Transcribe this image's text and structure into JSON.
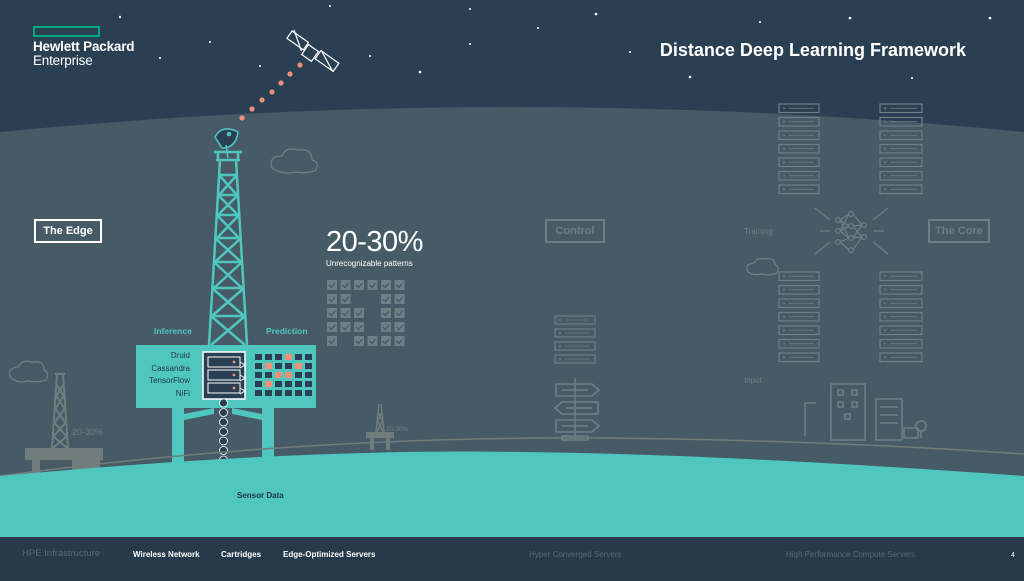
{
  "brand": {
    "line1": "Hewlett Packard",
    "line2": "Enterprise",
    "accent": "#01a982"
  },
  "title": "Distance Deep Learning Framework",
  "labels": {
    "the_edge": "The Edge",
    "control": "Control",
    "the_core": "The Core",
    "training": "Training",
    "input": "Input",
    "inference": "Inference",
    "prediction": "Prediction",
    "sensor_data": "Sensor Data"
  },
  "stat": {
    "value": "20-30%",
    "caption": "Unrecognizable patterns"
  },
  "small_stats": [
    "20-30%",
    "20-30%"
  ],
  "edge_stack": [
    "Druid",
    "Cassandra",
    "TensorFlow",
    "NiFi"
  ],
  "footer": {
    "hpe": "HPE Infrastructure",
    "items": [
      "Wireless Network",
      "Cartridges",
      "Edge-Optimized Servers",
      "Hyper Converged Servers",
      "High Performance Compute Servers"
    ]
  },
  "page_number": "4",
  "colors": {
    "background": "#2b3f52",
    "teal": "#4fc7bf",
    "ground": "#4fc7bf",
    "dim": "#6f7f86",
    "orange": "#f1907a",
    "white": "#ffffff"
  },
  "icons": [
    "satellite-icon",
    "satellite-dish-icon",
    "cloud-icon",
    "oil-rig-icon",
    "server-rack-icon",
    "neural-network-icon",
    "building-icon",
    "signpost-icon",
    "checkbox-grid-icon"
  ]
}
